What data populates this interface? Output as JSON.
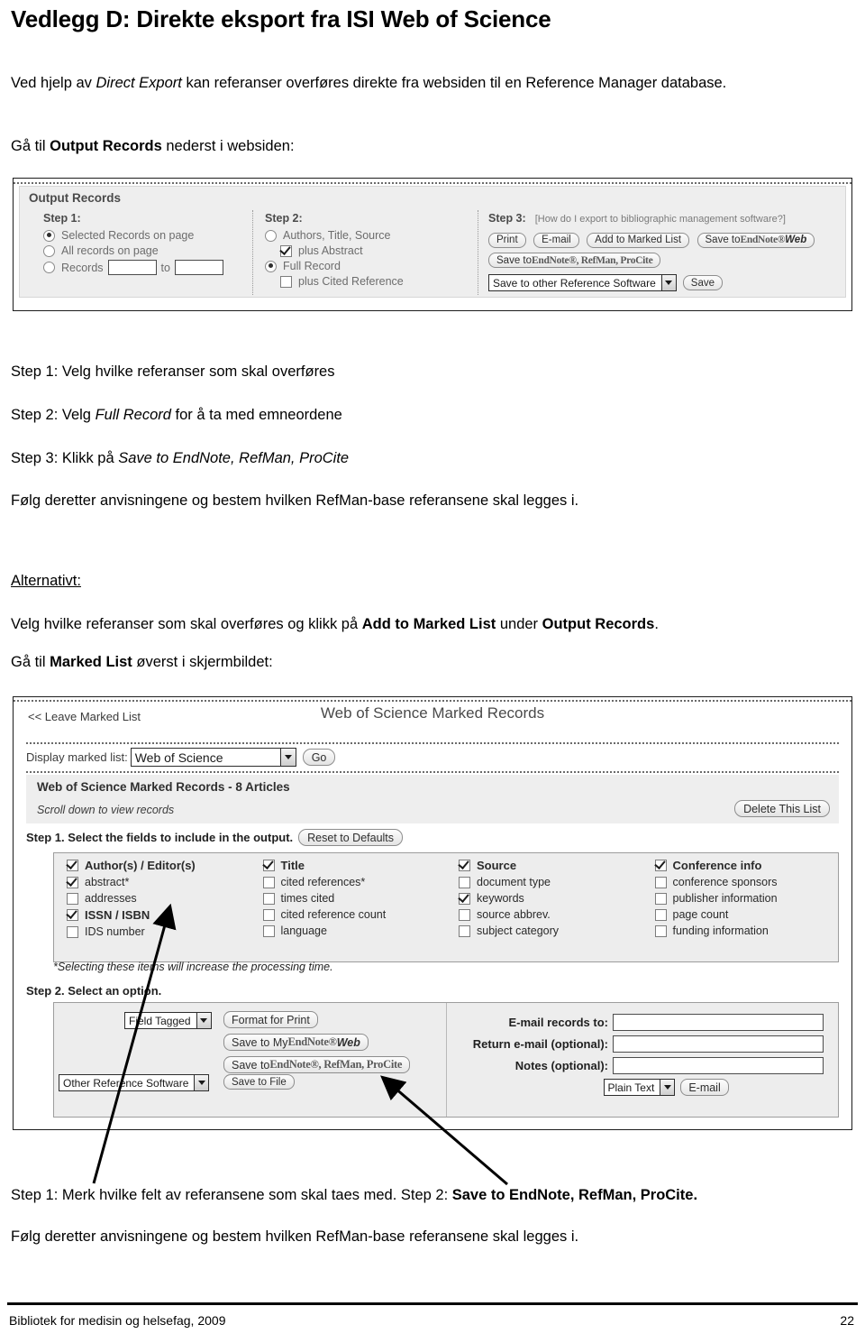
{
  "document": {
    "title": "Vedlegg D: Direkte eksport fra ISI Web of Science",
    "intro_html": "Ved hjelp av <i>Direct Export</i> kan referanser overføres direkte fra websiden til en Reference Manager database.",
    "goto_output_html": "Gå til <b>Output Records</b> nederst i websiden:",
    "step_1": "Step 1: Velg hvilke referanser som skal overføres",
    "step_2_html": "Step 2: Velg <i>Full Record</i> for å ta med emneordene",
    "step_3_html": "Step 3: Klikk på <i>Save to EndNote, RefMan, ProCite</i>",
    "follow_instructions": "Følg deretter anvisningene og bestem hvilken RefMan-base referansene skal legges i.",
    "alternative_label": "Alternativt:",
    "alternative_body_html": "Velg hvilke referanser som skal overføres og klikk på <b>Add to Marked List</b> under <b>Output Records</b>.",
    "goto_marked_list_html": "Gå til <b>Marked List</b> øverst i skjermbildet:",
    "bottom_steps_html": "Step 1: Merk hvilke felt av referansene som skal taes med. Step 2: <b>Save to EndNote, RefMan, ProCite.</b>",
    "bottom_follow": "Følg deretter anvisningene og bestem hvilken RefMan-base referansene skal legges i."
  },
  "footer": {
    "left": "Bibliotek for medisin og helsefag, 2009",
    "page_number": "22"
  },
  "output_records": {
    "panel_title": "Output Records",
    "step1": {
      "heading": "Step 1:",
      "options": [
        {
          "label": "Selected Records on page",
          "selected": true
        },
        {
          "label": "All records on page",
          "selected": false
        },
        {
          "label": "Records",
          "selected": false,
          "to_label": "to"
        }
      ]
    },
    "step2": {
      "heading": "Step 2:",
      "radio_authors": {
        "label": "Authors, Title, Source",
        "selected": false
      },
      "check_abstract": {
        "label": "plus Abstract",
        "checked": true
      },
      "radio_full": {
        "label": "Full Record",
        "selected": true
      },
      "check_cited": {
        "label": "plus Cited Reference",
        "checked": false
      }
    },
    "step3": {
      "heading": "Step 3:",
      "note": "[How do I export to bibliographic management software?]",
      "buttons": [
        "Print",
        "E-mail",
        "Add to Marked List"
      ],
      "save_endnote_web": {
        "prefix": "Save to ",
        "brand": "EndNote®",
        "suffix": "Web"
      },
      "save_endnote_refman": {
        "prefix": "Save to ",
        "brand": "EndNote®, RefMan, ProCite"
      },
      "other_software_select": "Save to other Reference Software",
      "save_button": "Save"
    }
  },
  "marked_list": {
    "leave_link": "<< Leave Marked List",
    "title": "Web of Science Marked Records",
    "display_label": "Display marked list:",
    "display_value": "Web of Science",
    "go_button": "Go",
    "records_heading": "Web of Science Marked Records - 8 Articles",
    "scroll_note": "Scroll down to view records",
    "delete_button": "Delete This List",
    "step1_text": "Step 1. Select the fields to include in the output.",
    "reset_button": "Reset to Defaults",
    "fields": [
      [
        {
          "label": "Author(s) / Editor(s)",
          "checked": true,
          "bold": true
        },
        {
          "label": "abstract*",
          "checked": true,
          "bold": false
        },
        {
          "label": "addresses",
          "checked": false,
          "bold": false
        },
        {
          "label": "ISSN / ISBN",
          "checked": true,
          "bold": true
        },
        {
          "label": "IDS number",
          "checked": false,
          "bold": false
        }
      ],
      [
        {
          "label": "Title",
          "checked": true,
          "bold": true
        },
        {
          "label": "cited references*",
          "checked": false,
          "bold": false
        },
        {
          "label": "times cited",
          "checked": false,
          "bold": false
        },
        {
          "label": "cited reference count",
          "checked": false,
          "bold": false
        },
        {
          "label": "language",
          "checked": false,
          "bold": false
        }
      ],
      [
        {
          "label": "Source",
          "checked": true,
          "bold": true
        },
        {
          "label": "document type",
          "checked": false,
          "bold": false
        },
        {
          "label": "keywords",
          "checked": true,
          "bold": false
        },
        {
          "label": "source abbrev.",
          "checked": false,
          "bold": false
        },
        {
          "label": "subject category",
          "checked": false,
          "bold": false
        }
      ],
      [
        {
          "label": "Conference info",
          "checked": true,
          "bold": true
        },
        {
          "label": "conference sponsors",
          "checked": false,
          "bold": false
        },
        {
          "label": "publisher information",
          "checked": false,
          "bold": false
        },
        {
          "label": "page count",
          "checked": false,
          "bold": false
        },
        {
          "label": "funding information",
          "checked": false,
          "bold": false
        }
      ]
    ],
    "fields_note": "*Selecting these items will increase the processing time.",
    "step2_text": "Step 2. Select an option.",
    "format_select": "Field Tagged",
    "other_software_select": "Other Reference Software",
    "format_print_button": "Format for Print",
    "save_my_endnote_web": {
      "prefix": "Save to My ",
      "brand": "EndNote®",
      "suffix": "Web"
    },
    "save_endnote_refman": {
      "prefix": "Save to ",
      "brand": "EndNote®, RefMan, ProCite"
    },
    "save_file_button": "Save to File",
    "email_fields": [
      {
        "label": "E-mail records to:",
        "value": ""
      },
      {
        "label": "Return e-mail (optional):",
        "value": ""
      },
      {
        "label": "Notes (optional):",
        "value": ""
      }
    ],
    "email_format_select": "Plain Text",
    "email_button": "E-mail"
  }
}
